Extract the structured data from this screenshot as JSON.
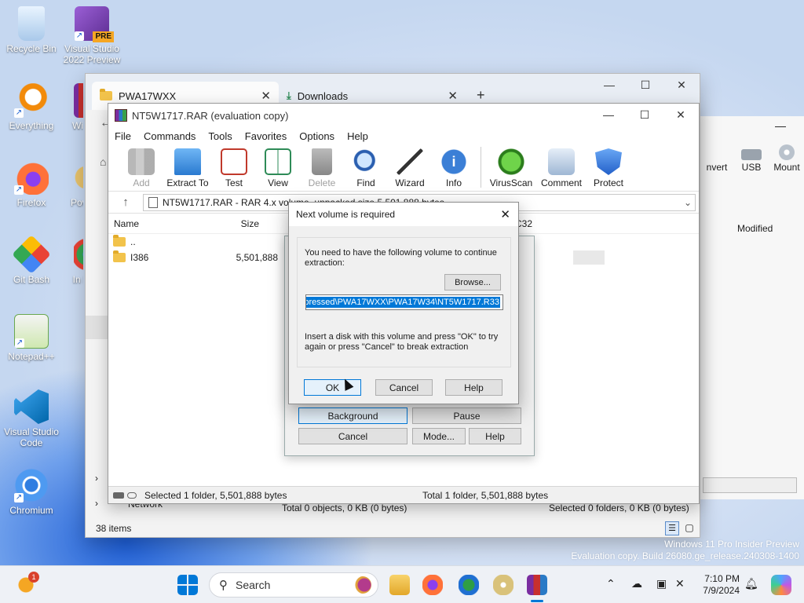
{
  "desktop": {
    "icons": [
      {
        "label": "Recycle Bin"
      },
      {
        "label": "Visual Studio 2022 Preview",
        "badge": "PRE"
      },
      {
        "label": "Everything"
      },
      {
        "label": "Wi"
      },
      {
        "label": "Firefox"
      },
      {
        "label": "Pov"
      },
      {
        "label": "Git Bash"
      },
      {
        "label": "In Do"
      },
      {
        "label": "Notepad++"
      },
      {
        "label": "Visual Studio Code"
      },
      {
        "label": "Chromium"
      }
    ]
  },
  "explorer": {
    "tabs": [
      {
        "label": "PWA17WXX"
      },
      {
        "label": "Downloads"
      }
    ],
    "new_tab": "+",
    "nav_items": [
      "Network"
    ],
    "status_items": "38 items",
    "status_total": "Total 0 objects, 0 KB (0 bytes)",
    "status_selected": "Selected 0 folders, 0 KB (0 bytes)"
  },
  "bg_explorer": {
    "toolbar": [
      {
        "label": "nvert"
      },
      {
        "label": "USB"
      },
      {
        "label": "Mount"
      }
    ],
    "col_modified": "Modified"
  },
  "winrar": {
    "title": "NT5W1717.RAR (evaluation copy)",
    "menu": [
      "File",
      "Commands",
      "Tools",
      "Favorites",
      "Options",
      "Help"
    ],
    "toolbar": [
      {
        "label": "Add",
        "disabled": true,
        "icon": "books-add-icon"
      },
      {
        "label": "Extract To",
        "icon": "folder-extract-icon"
      },
      {
        "label": "Test",
        "icon": "checklist-icon"
      },
      {
        "label": "View",
        "icon": "book-view-icon"
      },
      {
        "label": "Delete",
        "disabled": true,
        "icon": "trash-icon"
      },
      {
        "label": "Find",
        "icon": "magnifier-icon"
      },
      {
        "label": "Wizard",
        "icon": "wand-icon"
      },
      {
        "label": "Info",
        "icon": "info-icon"
      },
      {
        "label": "VirusScan",
        "icon": "bug-icon"
      },
      {
        "label": "Comment",
        "icon": "comment-icon"
      },
      {
        "label": "Protect",
        "icon": "shield-icon"
      }
    ],
    "path": "NT5W1717.RAR - RAR 4.x volume, unpacked size 5,501,888 bytes",
    "columns": {
      "name": "Name",
      "size": "Size",
      "crc": "C32"
    },
    "rows": [
      {
        "name": "..",
        "size": ""
      },
      {
        "name": "I386",
        "size": "5,501,888"
      }
    ],
    "status_left": "Selected 1 folder, 5,501,888 bytes",
    "status_right": "Total 1 folder, 5,501,888 bytes"
  },
  "progress_dialog": {
    "buttons": {
      "background": "Background",
      "pause": "Pause",
      "cancel": "Cancel",
      "mode": "Mode...",
      "help": "Help"
    }
  },
  "next_volume_dialog": {
    "title": "Next volume is required",
    "message": "You need to have the following volume to continue extraction:",
    "browse": "Browse...",
    "path_value": "pressed\\PWA17WXX\\PWA17W34\\NT5W1717.R33",
    "instruction": "Insert a disk with this volume and press \"OK\" to try again or press \"Cancel\" to break extraction",
    "ok": "OK",
    "cancel": "Cancel",
    "help": "Help"
  },
  "taskbar": {
    "search_placeholder": "Search",
    "time": "7:10 PM",
    "date": "7/9/2024",
    "notification_badge": "1",
    "accent": "#0078d7"
  },
  "watermark": {
    "line1": "Windows 11 Pro Insider Preview",
    "line2": "Evaluation copy. Build 26080.ge_release.240308-1400"
  }
}
